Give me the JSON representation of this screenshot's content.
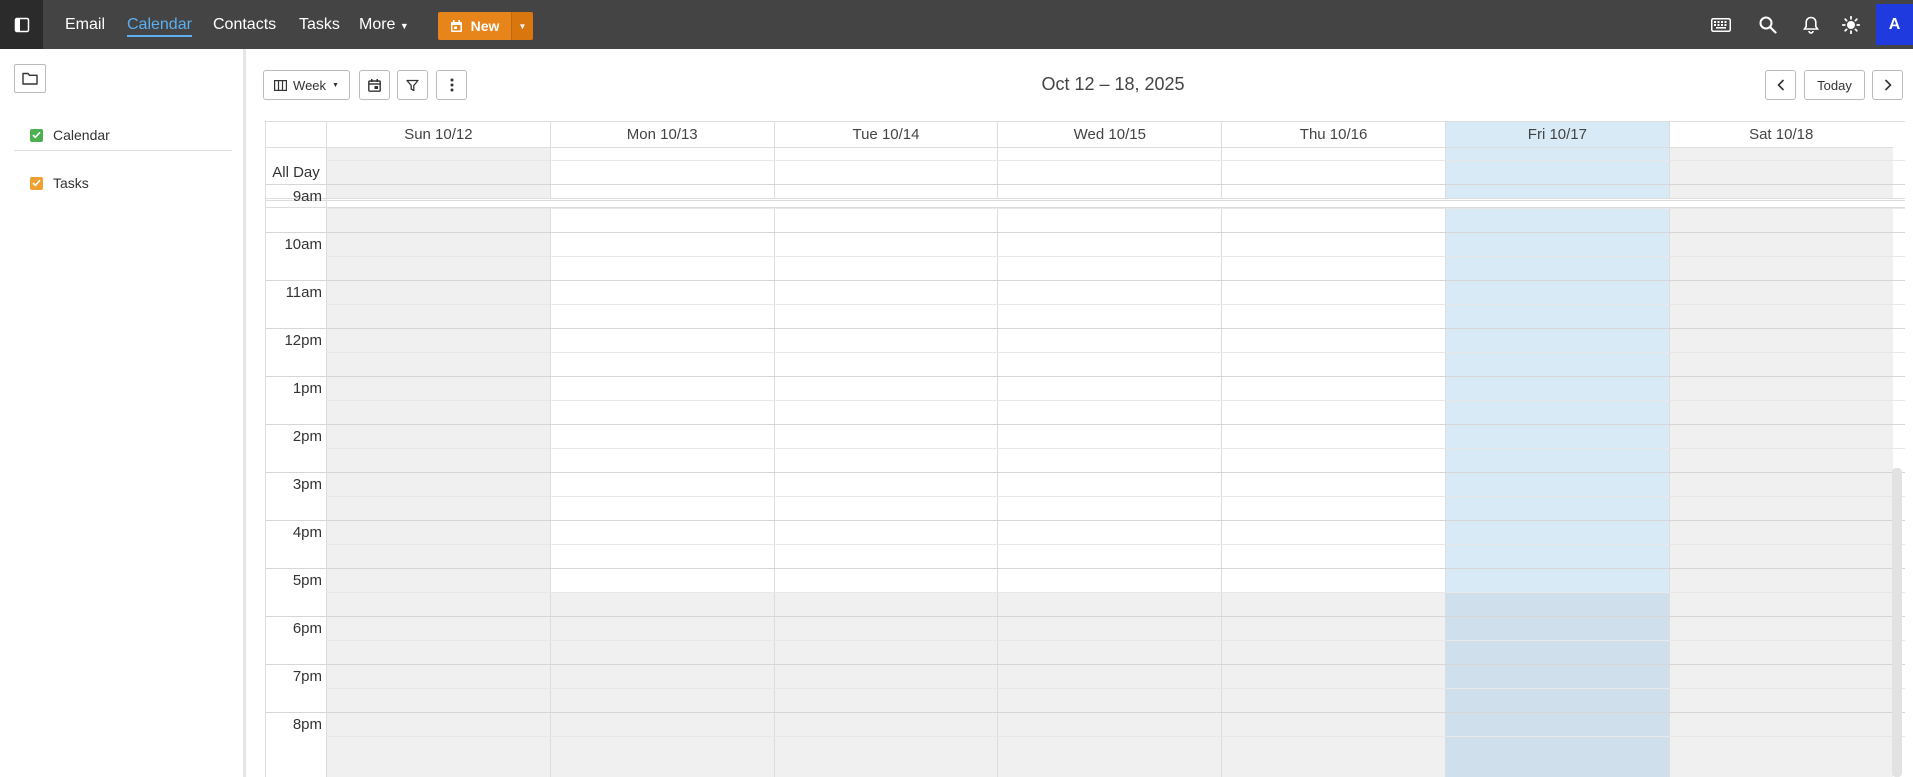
{
  "topbar": {
    "nav": [
      {
        "label": "Email",
        "name": "nav-email",
        "active": false
      },
      {
        "label": "Calendar",
        "name": "nav-calendar",
        "active": true
      },
      {
        "label": "Contacts",
        "name": "nav-contacts",
        "active": false
      },
      {
        "label": "Tasks",
        "name": "nav-tasks",
        "active": false
      },
      {
        "label": "More",
        "name": "nav-more",
        "active": false
      }
    ],
    "new_label": "New",
    "avatar_initial": "A",
    "icons": [
      "sidebar-toggle-icon",
      "keyboard-icon",
      "search-icon",
      "bell-icon",
      "sun-icon"
    ]
  },
  "sidebar": {
    "calendars": [
      {
        "label": "Calendar",
        "color": "#4caf50"
      },
      {
        "label": "Tasks",
        "color": "#f0a030"
      }
    ]
  },
  "toolbar": {
    "view_label": "Week",
    "range_title": "Oct 12 – 18, 2025",
    "today_label": "Today"
  },
  "grid": {
    "allday_label": "All Day",
    "days": [
      {
        "label": "Sun 10/12",
        "weekend": true,
        "today": false
      },
      {
        "label": "Mon 10/13",
        "weekend": false,
        "today": false
      },
      {
        "label": "Tue 10/14",
        "weekend": false,
        "today": false
      },
      {
        "label": "Wed 10/15",
        "weekend": false,
        "today": false
      },
      {
        "label": "Thu 10/16",
        "weekend": false,
        "today": false
      },
      {
        "label": "Fri 10/17",
        "weekend": false,
        "today": true
      },
      {
        "label": "Sat 10/18",
        "weekend": true,
        "today": false
      }
    ],
    "hours": [
      "9am",
      "10am",
      "11am",
      "12pm",
      "1pm",
      "2pm",
      "3pm",
      "4pm",
      "5pm",
      "6pm",
      "7pm",
      "8pm"
    ],
    "work_end_hour_label": "5pm",
    "colors": {
      "weekend": "#f0f0f0",
      "today": "#d8eaf6",
      "today_offhours": "#cfe0ec",
      "offhours": "#f0f0f0"
    }
  }
}
